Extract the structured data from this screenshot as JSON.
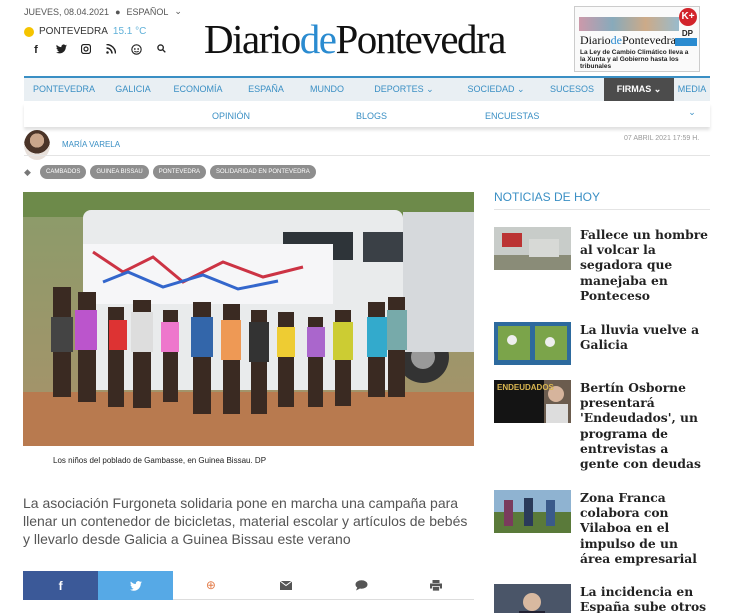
{
  "top": {
    "date": "JUEVES, 08.04.2021",
    "lang": "ESPAÑOL",
    "lang_caret": "⌄"
  },
  "weather": {
    "city": "PONTEVEDRA",
    "temp": "15.1 °C"
  },
  "social": [
    "f",
    "t",
    "ig",
    "rss",
    "tik",
    "search"
  ],
  "logo": {
    "part1": "Diario",
    "part2": "de",
    "part3": "Pontevedra"
  },
  "cover": {
    "title1": "Diario",
    "title2": "de",
    "title3": "Pontevedra",
    "headline": "La Ley de Cambio Climático lleva a la Xunta y al Gobierno hasta los tribunales",
    "badge": "K+",
    "dp": "DP"
  },
  "nav": [
    "PONTEVEDRA",
    "GALICIA",
    "ECONOMÍA",
    "ESPAÑA",
    "MUNDO",
    "DEPORTES ⌄",
    "SOCIEDAD ⌄",
    "SUCESOS",
    "FIRMAS ⌄",
    "MEDIA ⌄"
  ],
  "subnav": [
    "OPINIÓN",
    "BLOGS",
    "ENCUESTAS"
  ],
  "author": "MARÍA VARELA",
  "date": "07 ABRIL 2021 17:59 H.",
  "tags": [
    "CAMBADOS",
    "GUINEA BISSAU",
    "PONTEVEDRA",
    "SOLIDARIDAD EN PONTEVEDRA"
  ],
  "caption": "Los niños del poblado de Gambasse, en Guinea Bissau. DP",
  "lead": "La asociación Furgoneta solidaria pone en marcha una campaña para llenar un contenedor de bicicletas, material escolar y artículos de bebés y llevarlo desde Galicia a Guinea Bissau este verano",
  "share": [
    "f",
    "t",
    "wa",
    "mail",
    "comment",
    "print"
  ],
  "side_title": "NOTICIAS DE HOY",
  "news": [
    {
      "title": "Fallece un hombre al volcar la segadora que manejaba en Ponteceso"
    },
    {
      "title": "La lluvia vuelve a Galicia"
    },
    {
      "title": "Bertín Osborne presentará 'Endeudados', un programa de entrevistas a gente con deudas",
      "thumb_text": "ENDEUDADOS"
    },
    {
      "title": "Zona Franca colabora con Vilaboa en el impulso de un área empresarial"
    },
    {
      "title": "La incidencia en España sube otros"
    }
  ],
  "colors": {
    "accent": "#3a8fc4",
    "facebook": "#3b5998",
    "twitter": "#56a9e6"
  }
}
